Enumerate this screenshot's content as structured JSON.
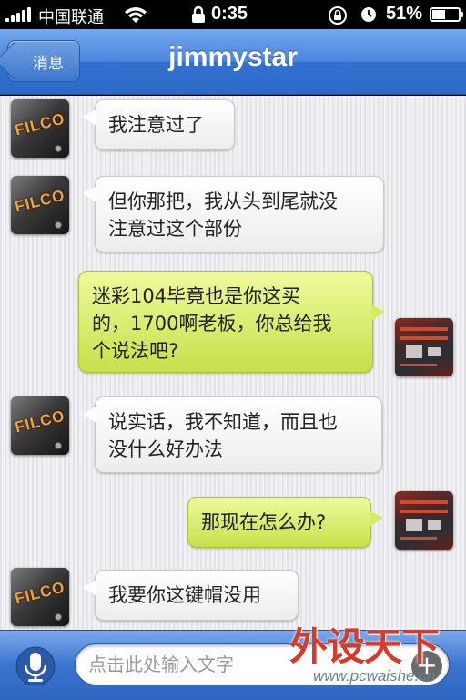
{
  "status_bar": {
    "carrier": "中国联通",
    "time": "0:35",
    "battery_percent_text": "51%",
    "battery_level": 0.51
  },
  "nav": {
    "back_label": "消息",
    "title": "jimmystar"
  },
  "messages": [
    {
      "side": "left",
      "avatar": "filco",
      "text": "我注意过了"
    },
    {
      "side": "left",
      "avatar": "filco",
      "text_lines": [
        "但你那把，我从头到尾就没",
        "注意过这个部份"
      ]
    },
    {
      "side": "right",
      "avatar": "motherboard",
      "text_lines": [
        "迷彩104毕竟也是你这买",
        "的，1700啊老板，你总给我",
        "个说法吧?"
      ]
    },
    {
      "side": "left",
      "avatar": "filco",
      "text_lines": [
        "说实话，我不知道，而且也",
        "没什么好办法"
      ]
    },
    {
      "side": "right",
      "avatar": "motherboard",
      "text": "那现在怎么办?"
    },
    {
      "side": "left",
      "avatar": "filco",
      "text": "我要你这键帽没用"
    }
  ],
  "avatar_logo_text": "FILCO",
  "input_bar": {
    "placeholder": "点击此处输入文字",
    "plus_label": "+"
  },
  "watermark": {
    "text": "外设天下",
    "url": "www.pcwaishe.cn"
  },
  "colors": {
    "nav_blue": "#3270cf",
    "bubble_green": "#d5eb63",
    "bubble_white": "#ffffff",
    "filco_orange": "#f3a23a"
  }
}
